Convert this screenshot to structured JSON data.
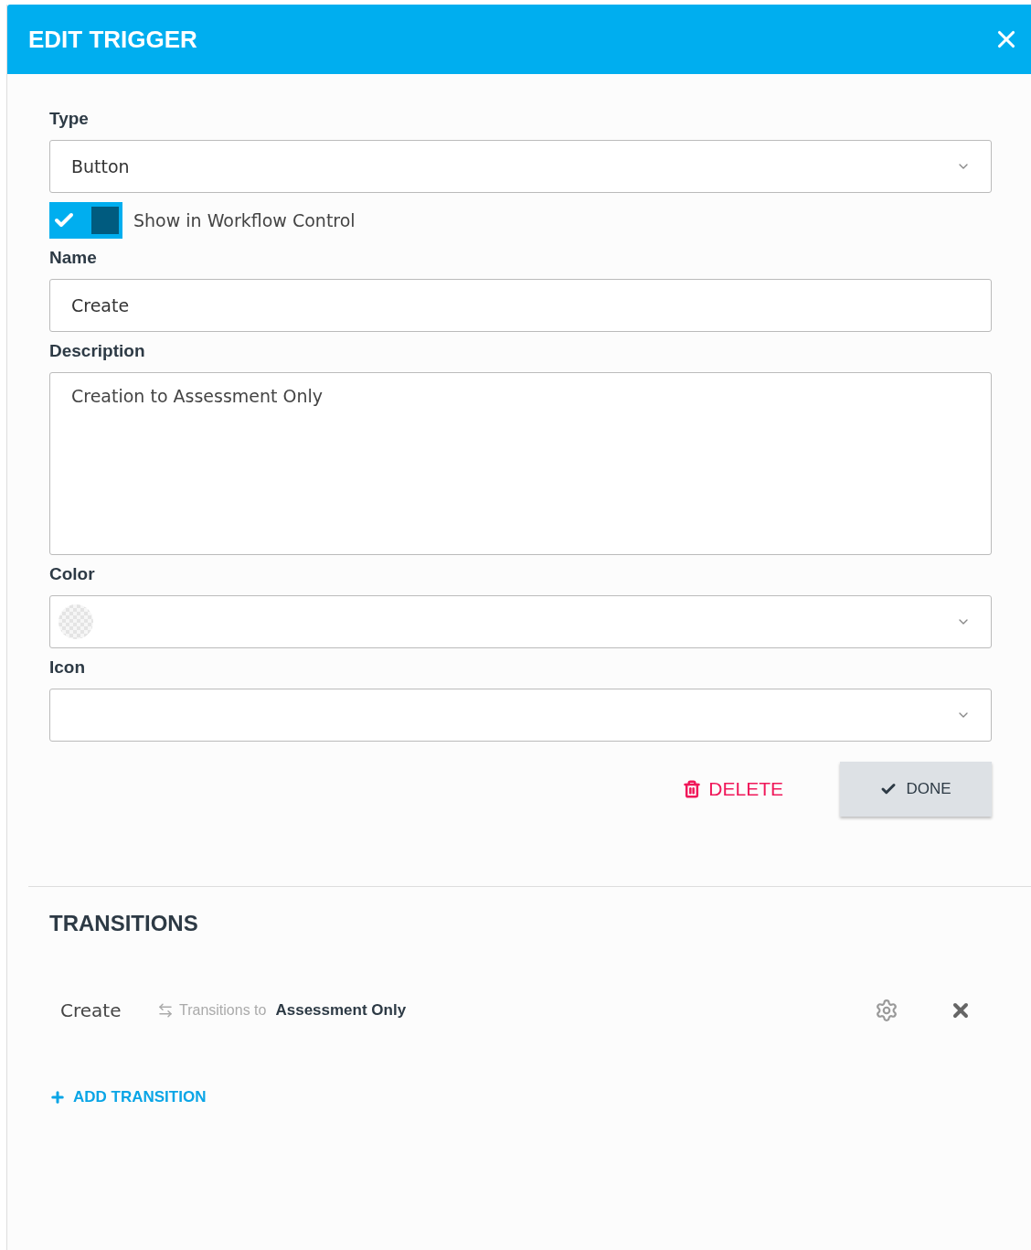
{
  "header": {
    "title": "EDIT TRIGGER"
  },
  "form": {
    "type": {
      "label": "Type",
      "value": "Button"
    },
    "toggle": {
      "label": "Show in Workflow Control",
      "on": true
    },
    "name": {
      "label": "Name",
      "value": "Create"
    },
    "description": {
      "label": "Description",
      "value": "Creation to Assessment Only"
    },
    "color": {
      "label": "Color"
    },
    "icon": {
      "label": "Icon"
    }
  },
  "actions": {
    "delete": "DELETE",
    "done": "DONE"
  },
  "transitions": {
    "title": "TRANSITIONS",
    "items": [
      {
        "name": "Create",
        "via": "Transitions to",
        "target": "Assessment Only"
      }
    ],
    "add": "ADD TRANSITION"
  }
}
